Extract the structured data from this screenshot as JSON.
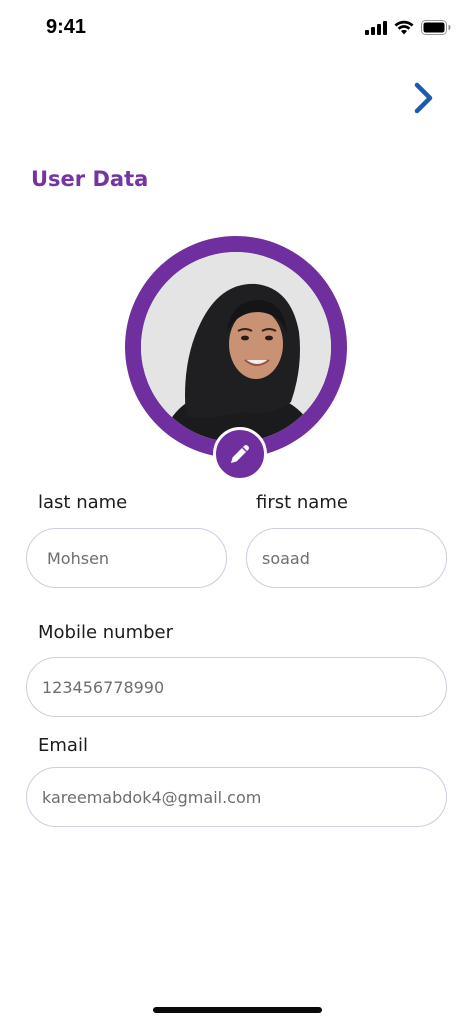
{
  "status_bar": {
    "time": "9:41"
  },
  "header": {
    "next_icon": "chevron-right-icon",
    "accent_color": "#1e5bb0"
  },
  "section": {
    "title": "User Data",
    "title_color": "#7434a3"
  },
  "avatar": {
    "ring_color": "#6f2f9f",
    "edit_icon": "pencil-icon"
  },
  "form": {
    "last_name": {
      "label": "last name",
      "value": "Mohsen"
    },
    "first_name": {
      "label": "first name",
      "value": "soaad"
    },
    "mobile": {
      "label": "Mobile number",
      "value": "123456778990"
    },
    "email": {
      "label": "Email",
      "value": "kareemabdok4@gmail.com"
    }
  }
}
